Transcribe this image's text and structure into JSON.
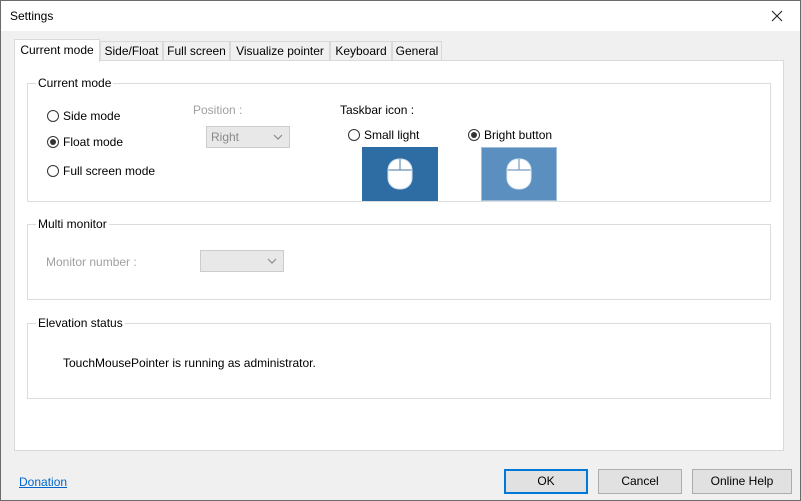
{
  "window": {
    "title": "Settings"
  },
  "tabs": [
    "Current mode",
    "Side/Float",
    "Full screen",
    "Visualize pointer",
    "Keyboard",
    "General"
  ],
  "current_mode": {
    "legend": "Current mode",
    "options": [
      {
        "label": "Side mode",
        "checked": false
      },
      {
        "label": "Float mode",
        "checked": true
      },
      {
        "label": "Full screen mode",
        "checked": false
      }
    ],
    "position_label": "Position :",
    "position_value": "Right",
    "taskbar_icon_label": "Taskbar icon :",
    "icon_options": [
      {
        "label": "Small light",
        "checked": false
      },
      {
        "label": "Bright button",
        "checked": true
      }
    ]
  },
  "multi_monitor": {
    "legend": "Multi monitor",
    "monitor_label": "Monitor number :",
    "monitor_value": ""
  },
  "elevation": {
    "legend": "Elevation status",
    "status_text": "TouchMousePointer is running as administrator."
  },
  "footer": {
    "donation_link": "Donation",
    "ok_label": "OK",
    "cancel_label": "Cancel",
    "help_label": "Online Help"
  },
  "colors": {
    "preview_dark": "#2e6ca4",
    "preview_light": "#5a8fc0",
    "accent": "#0078d7"
  }
}
